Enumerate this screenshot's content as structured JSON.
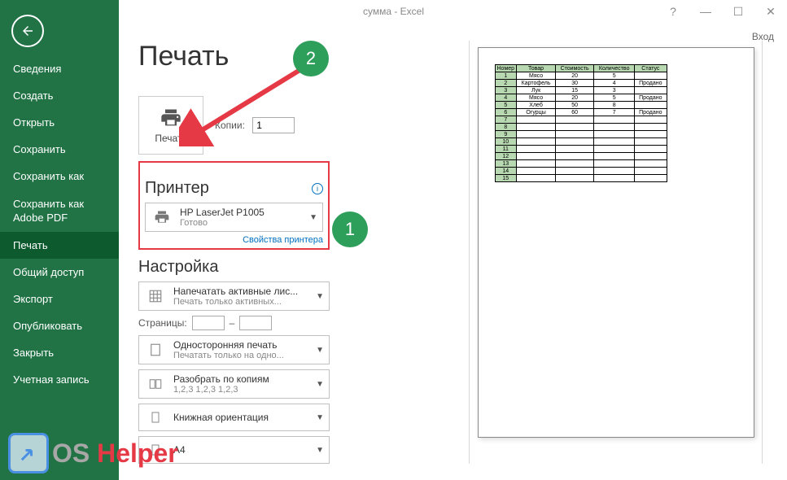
{
  "window": {
    "title": "сумма - Excel",
    "signin": "Вход"
  },
  "sidebar": {
    "items": [
      {
        "label": "Сведения"
      },
      {
        "label": "Создать"
      },
      {
        "label": "Открыть"
      },
      {
        "label": "Сохранить"
      },
      {
        "label": "Сохранить как"
      },
      {
        "label": "Сохранить как Adobe PDF"
      },
      {
        "label": "Печать"
      },
      {
        "label": "Общий доступ"
      },
      {
        "label": "Экспорт"
      },
      {
        "label": "Опубликовать"
      },
      {
        "label": "Закрыть"
      },
      {
        "label": "Учетная запись"
      }
    ],
    "activeIndex": 6
  },
  "page": {
    "title": "Печать"
  },
  "print": {
    "button": "Печать",
    "copies_label": "Копии:",
    "copies_value": "1"
  },
  "printer": {
    "heading": "Принтер",
    "name": "HP LaserJet P1005",
    "status": "Готово",
    "properties": "Свойства принтера"
  },
  "settings": {
    "heading": "Настройка",
    "what": {
      "t1": "Напечатать активные лис...",
      "t2": "Печать только активных..."
    },
    "pages_label": "Страницы:",
    "pages_from": "",
    "pages_to_lbl": "–",
    "pages_to": "",
    "sides": {
      "t1": "Односторонняя печать",
      "t2": "Печатать только на одно..."
    },
    "collate": {
      "t1": "Разобрать по копиям",
      "t2": "1,2,3   1,2,3   1,2,3"
    },
    "orient": {
      "t1": "Книжная ориентация",
      "t2": ""
    },
    "paper": {
      "t1": "A4",
      "t2": ""
    }
  },
  "callouts": {
    "step1": "1",
    "step2": "2"
  },
  "preview_table": {
    "headers": [
      "Номер",
      "Товар",
      "Стоимость",
      "Количество",
      "Статус"
    ],
    "rows": [
      [
        "1",
        "Мясо",
        "20",
        "5",
        ""
      ],
      [
        "2",
        "Картофель",
        "30",
        "4",
        "Продано"
      ],
      [
        "3",
        "Лук",
        "15",
        "3",
        ""
      ],
      [
        "4",
        "Мясо",
        "20",
        "5",
        "Продано"
      ],
      [
        "5",
        "Хлеб",
        "50",
        "8",
        ""
      ],
      [
        "6",
        "Огурцы",
        "60",
        "7",
        "Продано"
      ],
      [
        "7",
        "",
        "",
        "",
        ""
      ],
      [
        "8",
        "",
        "",
        "",
        ""
      ],
      [
        "9",
        "",
        "",
        "",
        ""
      ],
      [
        "10",
        "",
        "",
        "",
        ""
      ],
      [
        "11",
        "",
        "",
        "",
        ""
      ],
      [
        "12",
        "",
        "",
        "",
        ""
      ],
      [
        "13",
        "",
        "",
        "",
        ""
      ],
      [
        "14",
        "",
        "",
        "",
        ""
      ],
      [
        "15",
        "",
        "",
        "",
        ""
      ]
    ]
  },
  "brand": {
    "os": "OS",
    "helper": "Helper"
  }
}
